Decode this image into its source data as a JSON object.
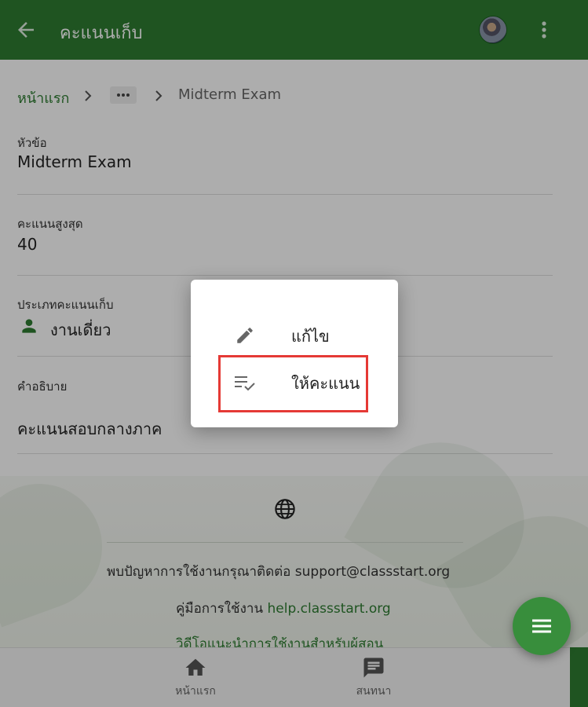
{
  "appbar": {
    "title": "คะแนนเก็บ",
    "back_icon": "arrow-left-icon",
    "more_icon": "more-vert-icon",
    "background": "#2e7d32"
  },
  "breadcrumb": {
    "home": "หน้าแรก",
    "ellipsis": "•••",
    "current": "Midterm Exam"
  },
  "fields": {
    "topic": {
      "label": "หัวข้อ",
      "value": "Midterm Exam"
    },
    "max_score": {
      "label": "คะแนนสูงสุด",
      "value": "40"
    },
    "type": {
      "label": "ประเภทคะแนนเก็บ",
      "value": "งานเดี่ยว",
      "icon": "person-icon"
    },
    "description": {
      "label": "คำอธิบาย",
      "value": "คะแนนสอบกลางภาค"
    }
  },
  "footer": {
    "support_text": "พบปัญหาการใช้งานกรุณาติดต่อ support@classstart.org",
    "manual_label": "คู่มือการใช้งาน",
    "manual_link": "help.classstart.org",
    "video_link": "วิดีโอแนะนำการใช้งานสำหรับผู้สอน"
  },
  "menu": {
    "items": [
      {
        "label": "แก้ไข",
        "icon": "pencil-icon"
      },
      {
        "label": "ให้คะแนน",
        "icon": "playlist-check-icon",
        "highlighted": true
      }
    ]
  },
  "bottom_nav": {
    "items": [
      {
        "label": "หน้าแรก",
        "icon": "home-icon"
      },
      {
        "label": "สนทนา",
        "icon": "chat-icon"
      }
    ]
  },
  "fab": {
    "icon": "menu-icon",
    "color": "#388e3c"
  },
  "colors": {
    "accent": "#2e7d32",
    "highlight_border": "#e53935"
  }
}
